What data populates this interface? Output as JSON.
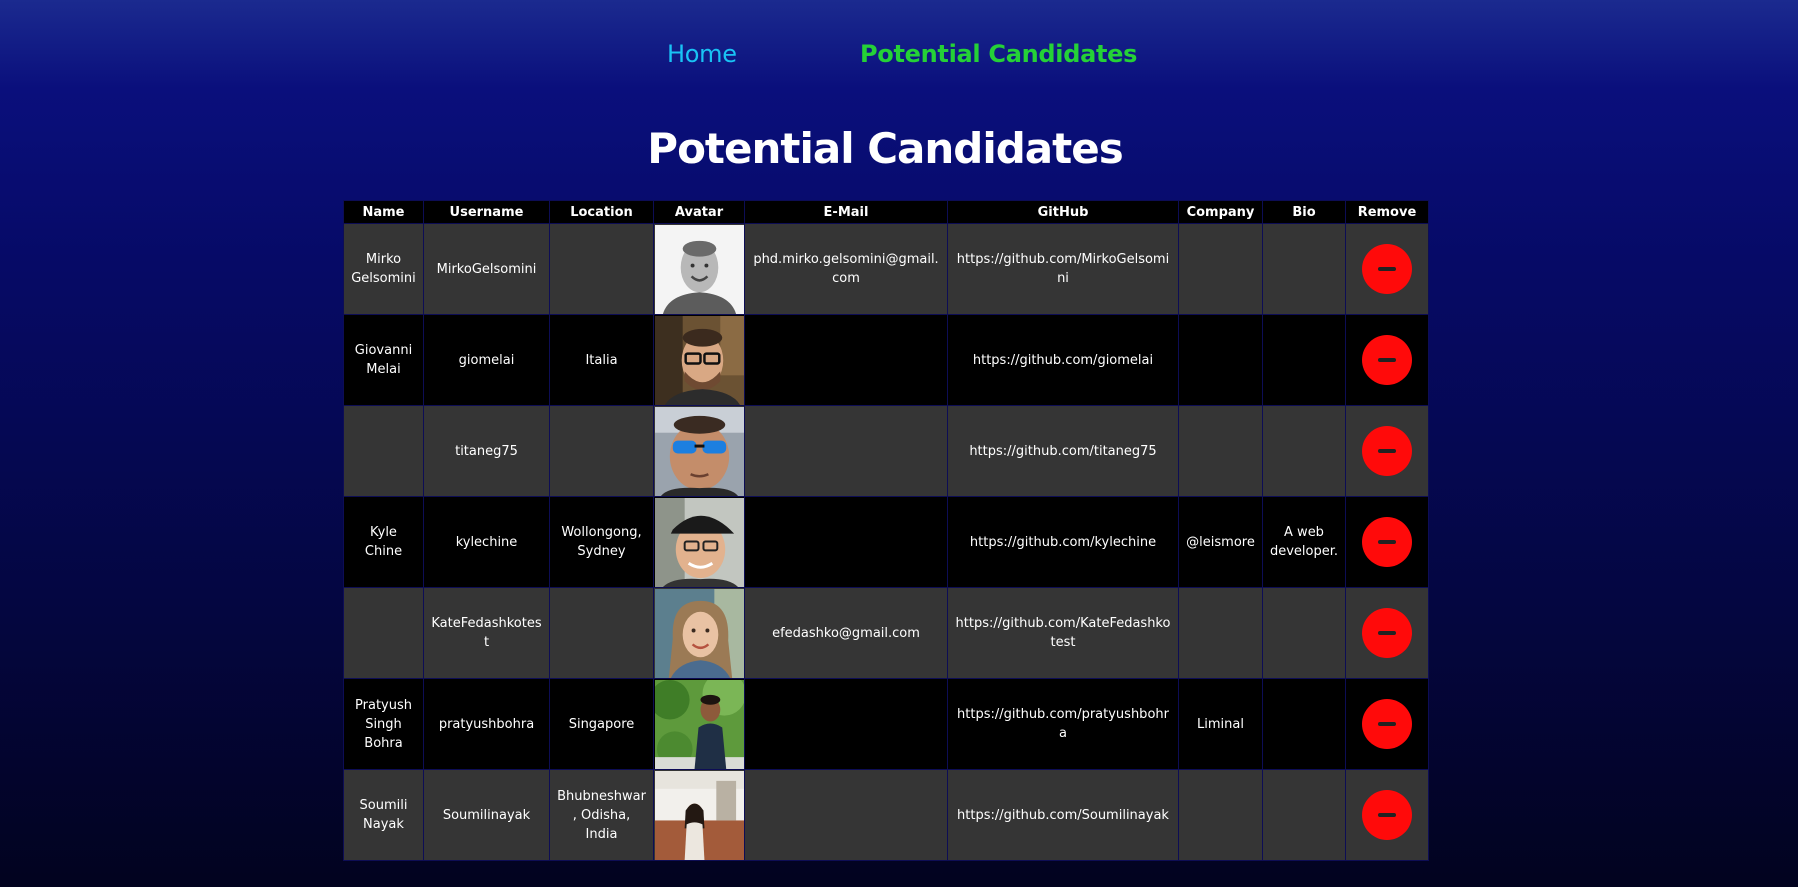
{
  "nav": {
    "home_label": "Home",
    "candidates_label": "Potential Candidates"
  },
  "page_title": "Potential Candidates",
  "table": {
    "headers": [
      "Name",
      "Username",
      "Location",
      "Avatar",
      "E-Mail",
      "GitHub",
      "Company",
      "Bio",
      "Remove"
    ],
    "rows": [
      {
        "name": "Mirko Gelsomini",
        "username": "MirkoGelsomini",
        "location": "",
        "avatar": "avatar-photo-bw-man-smiling",
        "email": "phd.mirko.gelsomini@gmail.com",
        "github": "https://github.com/MirkoGelsomini",
        "company": "",
        "bio": ""
      },
      {
        "name": "Giovanni Melai",
        "username": "giomelai",
        "location": "Italia",
        "avatar": "avatar-photo-man-glasses",
        "email": "",
        "github": "https://github.com/giomelai",
        "company": "",
        "bio": ""
      },
      {
        "name": "",
        "username": "titaneg75",
        "location": "",
        "avatar": "avatar-photo-man-blue-sunglasses",
        "email": "",
        "github": "https://github.com/titaneg75",
        "company": "",
        "bio": ""
      },
      {
        "name": "Kyle Chine",
        "username": "kylechine",
        "location": "Wollongong, Sydney",
        "avatar": "avatar-photo-man-cap-glasses",
        "email": "",
        "github": "https://github.com/kylechine",
        "company": "@leismore",
        "bio": "A web developer."
      },
      {
        "name": "",
        "username": "KateFedashkotest",
        "location": "",
        "avatar": "avatar-photo-woman-smiling",
        "email": "efedashko@gmail.com",
        "github": "https://github.com/KateFedashkotest",
        "company": "",
        "bio": ""
      },
      {
        "name": "Pratyush Singh Bohra",
        "username": "pratyushbohra",
        "location": "Singapore",
        "avatar": "avatar-photo-man-outdoors-trees",
        "email": "",
        "github": "https://github.com/pratyushbohra",
        "company": "Liminal",
        "bio": ""
      },
      {
        "name": "Soumili Nayak",
        "username": "Soumilinayak",
        "location": "Bhubneshwar, Odisha, India",
        "avatar": "avatar-photo-woman-standing",
        "email": "",
        "github": "https://github.com/Soumilinayak",
        "company": "",
        "bio": ""
      }
    ],
    "remove_icon": "minus-icon"
  },
  "colors": {
    "home_link": "#19c3f5",
    "active_link": "#25d137",
    "remove_button": "#ff0a0a",
    "row_odd": "#353535",
    "row_even": "#000000"
  }
}
